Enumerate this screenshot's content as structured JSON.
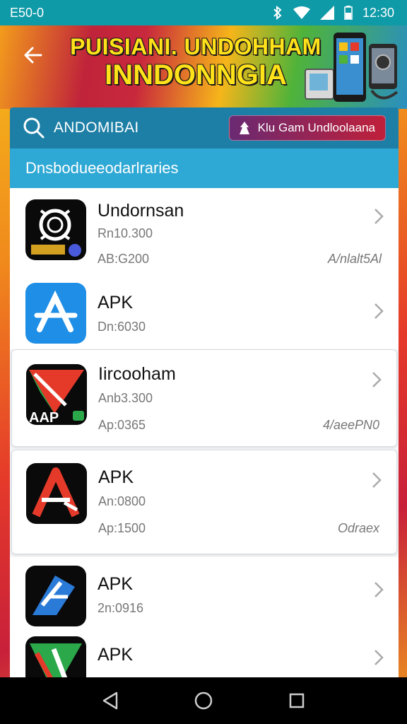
{
  "status_bar": {
    "left_text": "E50-0",
    "time": "12:30",
    "icons": [
      "bluetooth-icon",
      "wifi-icon",
      "signal-icon",
      "battery-icon"
    ]
  },
  "banner": {
    "title_line1": "PUISIANI. UNDOHHAM",
    "title_line2": "INNDONNGIA"
  },
  "search": {
    "text": "ANDOMIBAI",
    "promo_label": "Klu Gam Undloolaana"
  },
  "section": {
    "title": "Dnsbodueeodarlraries"
  },
  "apps": [
    {
      "name": "Undornsan",
      "line1": "Rn10.300",
      "line2": "AB:G200",
      "extra": "A/nlalt5Al"
    },
    {
      "name": "APK",
      "line1": "Dn:6030",
      "line2": "",
      "extra": ""
    },
    {
      "name": "Iircooham",
      "line1": "Anb3.300",
      "line2": "Ap:0365",
      "extra": "4/aeePN0",
      "icon_badge": "AAP"
    },
    {
      "name": "APK",
      "line1": "An:0800",
      "line2": "Ap:1500",
      "extra": "Odraex"
    },
    {
      "name": "APK",
      "line1": "2n:0916",
      "line2": "",
      "extra": ""
    },
    {
      "name": "APK",
      "line1": "",
      "line2": "",
      "extra": ""
    }
  ],
  "colors": {
    "status_bar": "#0f9aa8",
    "search_bar": "#1d7fa6",
    "subheader": "#2ea8d4",
    "banner_title": "#ffe21a"
  }
}
